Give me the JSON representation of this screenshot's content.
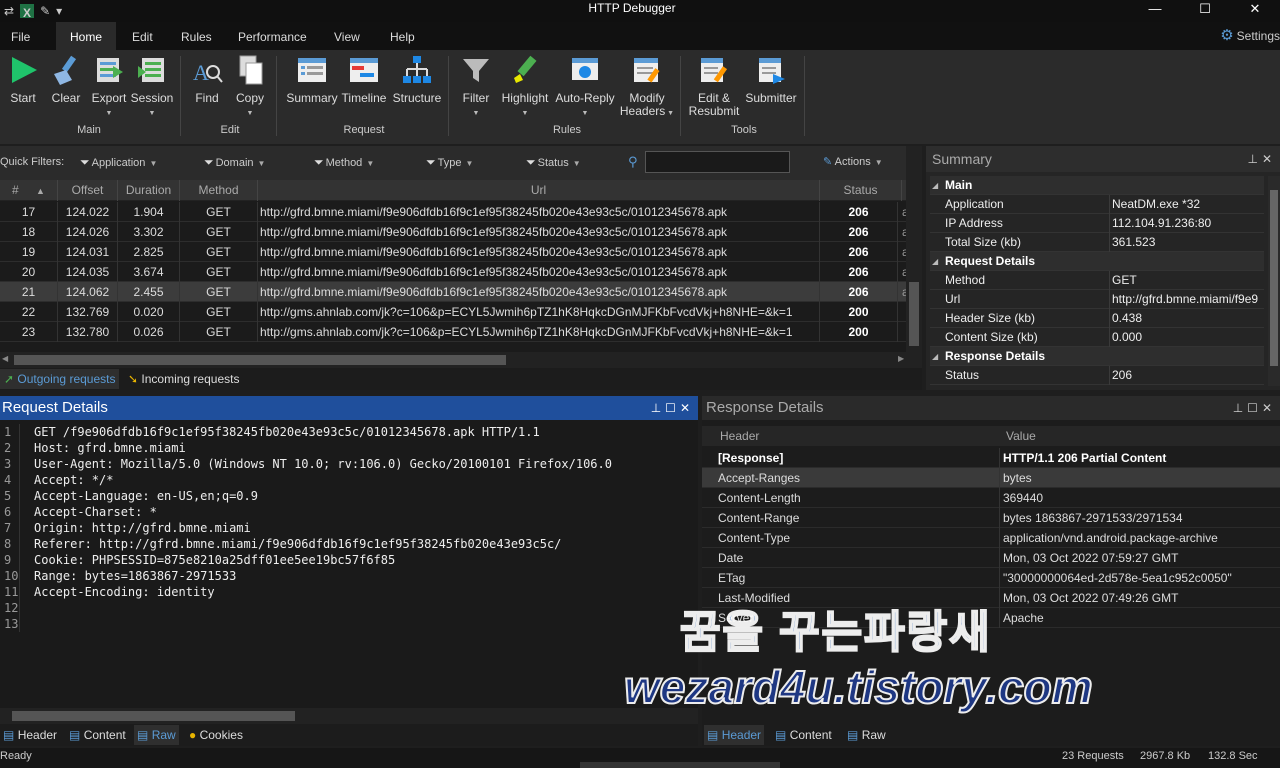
{
  "app": {
    "title": "HTTP Debugger"
  },
  "menu": {
    "file": "File",
    "tabs": [
      "Home",
      "Edit",
      "Rules",
      "Performance",
      "View",
      "Help"
    ],
    "settings": "Settings"
  },
  "ribbon": {
    "main": {
      "label": "Main",
      "start": "Start",
      "clear": "Clear",
      "export": "Export",
      "session": "Session"
    },
    "edit": {
      "label": "Edit",
      "find": "Find",
      "copy": "Copy"
    },
    "request": {
      "label": "Request",
      "summary": "Summary",
      "timeline": "Timeline",
      "structure": "Structure"
    },
    "rules": {
      "label": "Rules",
      "filter": "Filter",
      "highlight": "Highlight",
      "autoreply": "Auto-Reply",
      "modify_headers_1": "Modify",
      "modify_headers_2": "Headers"
    },
    "tools": {
      "label": "Tools",
      "edit_resubmit_1": "Edit &",
      "edit_resubmit_2": "Resubmit",
      "submitter": "Submitter"
    }
  },
  "filters": {
    "label": "Quick Filters:",
    "application": "Application",
    "domain": "Domain",
    "method": "Method",
    "type": "Type",
    "status": "Status",
    "actions": "Actions"
  },
  "grid": {
    "columns": {
      "num": "#",
      "offset": "Offset",
      "duration": "Duration",
      "method": "Method",
      "url": "Url",
      "status": "Status"
    },
    "rows": [
      {
        "num": "17",
        "offset": "124.022",
        "duration": "1.904",
        "method": "GET",
        "url": "http://gfrd.bmne.miami/f9e906dfdb16f9c1ef95f38245fb020e43e93c5c/01012345678.apk",
        "status": "206",
        "extra": "a"
      },
      {
        "num": "18",
        "offset": "124.026",
        "duration": "3.302",
        "method": "GET",
        "url": "http://gfrd.bmne.miami/f9e906dfdb16f9c1ef95f38245fb020e43e93c5c/01012345678.apk",
        "status": "206",
        "extra": "a"
      },
      {
        "num": "19",
        "offset": "124.031",
        "duration": "2.825",
        "method": "GET",
        "url": "http://gfrd.bmne.miami/f9e906dfdb16f9c1ef95f38245fb020e43e93c5c/01012345678.apk",
        "status": "206",
        "extra": "a"
      },
      {
        "num": "20",
        "offset": "124.035",
        "duration": "3.674",
        "method": "GET",
        "url": "http://gfrd.bmne.miami/f9e906dfdb16f9c1ef95f38245fb020e43e93c5c/01012345678.apk",
        "status": "206",
        "extra": "a"
      },
      {
        "num": "21",
        "offset": "124.062",
        "duration": "2.455",
        "method": "GET",
        "url": "http://gfrd.bmne.miami/f9e906dfdb16f9c1ef95f38245fb020e43e93c5c/01012345678.apk",
        "status": "206",
        "extra": "a"
      },
      {
        "num": "22",
        "offset": "132.769",
        "duration": "0.020",
        "method": "GET",
        "url": "http://gms.ahnlab.com/jk?c=106&p=ECYL5Jwmih6pTZ1hK8HqkcDGnMJFKbFvcdVkj+h8NHE=&k=1",
        "status": "200",
        "extra": ""
      },
      {
        "num": "23",
        "offset": "132.780",
        "duration": "0.026",
        "method": "GET",
        "url": "http://gms.ahnlab.com/jk?c=106&p=ECYL5Jwmih6pTZ1hK8HqkcDGnMJFKbFvcdVkj+h8NHE=&k=1",
        "status": "200",
        "extra": ""
      }
    ],
    "tabs": {
      "outgoing": "Outgoing requests",
      "incoming": "Incoming requests"
    }
  },
  "summary": {
    "title": "Summary",
    "sections": {
      "main": "Main",
      "request": "Request Details",
      "response": "Response Details"
    },
    "rows": {
      "application": {
        "k": "Application",
        "v": "NeatDM.exe *32"
      },
      "ip": {
        "k": "IP Address",
        "v": "112.104.91.236:80"
      },
      "total": {
        "k": "Total Size (kb)",
        "v": "361.523"
      },
      "method": {
        "k": "Method",
        "v": "GET"
      },
      "url": {
        "k": "Url",
        "v": "http://gfrd.bmne.miami/f9e9"
      },
      "hdrsize": {
        "k": "Header Size (kb)",
        "v": "0.438"
      },
      "contsize": {
        "k": "Content Size (kb)",
        "v": "0.000"
      },
      "status": {
        "k": "Status",
        "v": "206"
      }
    }
  },
  "request_details": {
    "title": "Request Details",
    "lines": [
      "GET /f9e906dfdb16f9c1ef95f38245fb020e43e93c5c/01012345678.apk HTTP/1.1",
      "Host: gfrd.bmne.miami",
      "User-Agent: Mozilla/5.0 (Windows NT 10.0; rv:106.0) Gecko/20100101 Firefox/106.0",
      "Accept: */*",
      "Accept-Language: en-US,en;q=0.9",
      "Accept-Charset: *",
      "Origin: http://gfrd.bmne.miami",
      "Referer: http://gfrd.bmne.miami/f9e906dfdb16f9c1ef95f38245fb020e43e93c5c/",
      "Cookie: PHPSESSID=875e8210a25dff01ee5ee19bc57f6f85",
      "Range: bytes=1863867-2971533",
      "Accept-Encoding: identity",
      "",
      ""
    ],
    "tabs": {
      "header": "Header",
      "content": "Content",
      "raw": "Raw",
      "cookies": "Cookies"
    }
  },
  "response_details": {
    "title": "Response Details",
    "columns": {
      "header": "Header",
      "value": "Value"
    },
    "rows": [
      {
        "k": "[Response]",
        "v": "HTTP/1.1 206 Partial Content"
      },
      {
        "k": "Accept-Ranges",
        "v": "bytes"
      },
      {
        "k": "Content-Length",
        "v": "369440"
      },
      {
        "k": "Content-Range",
        "v": "bytes 1863867-2971533/2971534"
      },
      {
        "k": "Content-Type",
        "v": "application/vnd.android.package-archive"
      },
      {
        "k": "Date",
        "v": "Mon, 03 Oct 2022 07:59:27 GMT"
      },
      {
        "k": "ETag",
        "v": "\"30000000064ed-2d578e-5ea1c952c0050\""
      },
      {
        "k": "Last-Modified",
        "v": "Mon, 03 Oct 2022 07:49:26 GMT"
      },
      {
        "k": "Server",
        "v": "Apache"
      }
    ],
    "tabs": {
      "header": "Header",
      "content": "Content",
      "raw": "Raw"
    }
  },
  "watermark": {
    "line1": "꿈을 꾸는파랑새",
    "line2": "wezard4u.tistory.com"
  },
  "statusbar": {
    "ready": "Ready",
    "requests": "23 Requests",
    "size": "2967.8 Kb",
    "time": "132.8 Sec"
  }
}
